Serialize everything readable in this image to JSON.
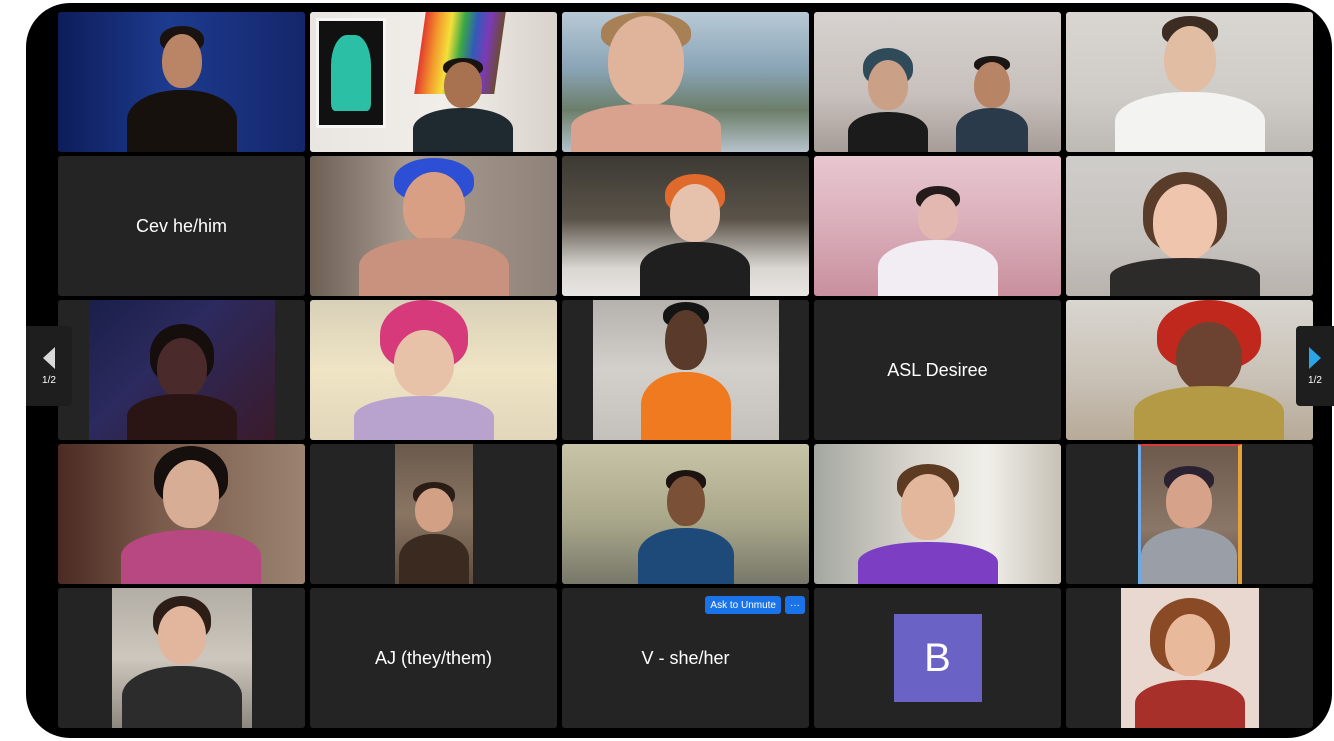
{
  "meeting": {
    "pager_left": {
      "page": "1/2",
      "icon": "chevron-left-icon"
    },
    "pager_right": {
      "page": "1/2",
      "icon": "chevron-right-icon",
      "color": "#2aa5e8"
    },
    "active_speaker_color": "#2fbb3f",
    "tiles": [
      {
        "kind": "video"
      },
      {
        "kind": "video",
        "active": true
      },
      {
        "kind": "video"
      },
      {
        "kind": "video"
      },
      {
        "kind": "video"
      },
      {
        "kind": "name",
        "name": "Cev he/him"
      },
      {
        "kind": "video"
      },
      {
        "kind": "video"
      },
      {
        "kind": "video"
      },
      {
        "kind": "video"
      },
      {
        "kind": "video"
      },
      {
        "kind": "video"
      },
      {
        "kind": "video"
      },
      {
        "kind": "name",
        "name": "ASL Desiree"
      },
      {
        "kind": "video"
      },
      {
        "kind": "video"
      },
      {
        "kind": "video"
      },
      {
        "kind": "video"
      },
      {
        "kind": "video"
      },
      {
        "kind": "video"
      },
      {
        "kind": "video"
      },
      {
        "kind": "name",
        "name": "AJ (they/them)"
      },
      {
        "kind": "name",
        "name": "V - she/her",
        "ask_to_unmute": "Ask to Unmute",
        "more": "···"
      },
      {
        "kind": "avatar",
        "initial": "B",
        "avatar_color": "#6a62c4"
      },
      {
        "kind": "video"
      }
    ]
  }
}
